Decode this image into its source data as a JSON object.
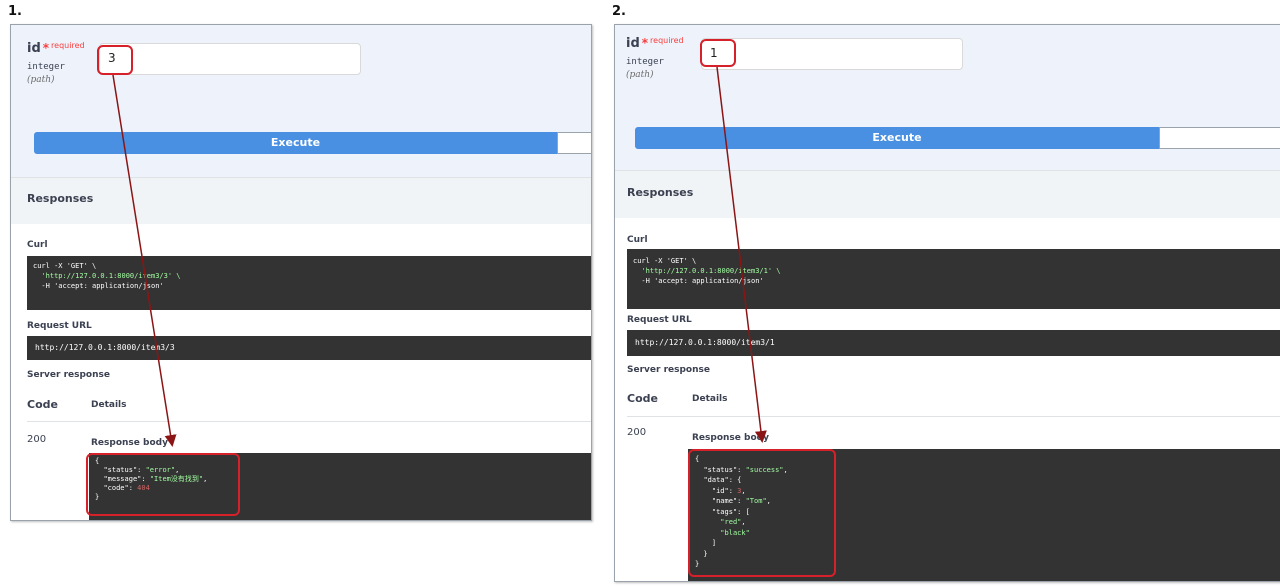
{
  "panels": [
    {
      "number": "1.",
      "param_name": "id",
      "param_star": "*",
      "param_required": "required",
      "param_type": "integer",
      "param_location": "(path)",
      "input_value": "3",
      "execute_label": "Execute",
      "responses_title": "Responses",
      "curl_label": "Curl",
      "curl_line1": "curl -X 'GET' \\",
      "curl_line2": "  'http://127.0.0.1:8000/item3/3' \\",
      "curl_line3": "  -H 'accept: application/json'",
      "request_url_label": "Request URL",
      "request_url": "http://127.0.0.1:8000/item3/3",
      "server_response_label": "Server response",
      "code_header": "Code",
      "details_header": "Details",
      "status_code": "200",
      "response_body_label": "Response body",
      "response_lines": [
        "{",
        "  \"status\": \"error\",",
        "  \"message\": \"Item没有找到\",",
        "  \"code\": 404",
        "}"
      ]
    },
    {
      "number": "2.",
      "param_name": "id",
      "param_star": "*",
      "param_required": "required",
      "param_type": "integer",
      "param_location": "(path)",
      "input_value": "1",
      "execute_label": "Execute",
      "responses_title": "Responses",
      "curl_label": "Curl",
      "curl_line1": "curl -X 'GET' \\",
      "curl_line2": "  'http://127.0.0.1:8000/item3/1' \\",
      "curl_line3": "  -H 'accept: application/json'",
      "request_url_label": "Request URL",
      "request_url": "http://127.0.0.1:8000/item3/1",
      "server_response_label": "Server response",
      "code_header": "Code",
      "details_header": "Details",
      "status_code": "200",
      "response_body_label": "Response body",
      "response_lines": [
        "{",
        "  \"status\": \"success\",",
        "  \"data\": {",
        "    \"id\": 3,",
        "    \"name\": \"Tom\",",
        "    \"tags\": [",
        "      \"red\",",
        "      \"black\"",
        "    ]",
        "  }",
        "}"
      ]
    }
  ],
  "colors": {
    "execute_blue": "#4990e2",
    "highlight_red": "#d6202a",
    "arrow_red": "#8b1515",
    "code_bg": "#333333",
    "string_green": "#a2fca2",
    "number_red": "#d36363"
  }
}
